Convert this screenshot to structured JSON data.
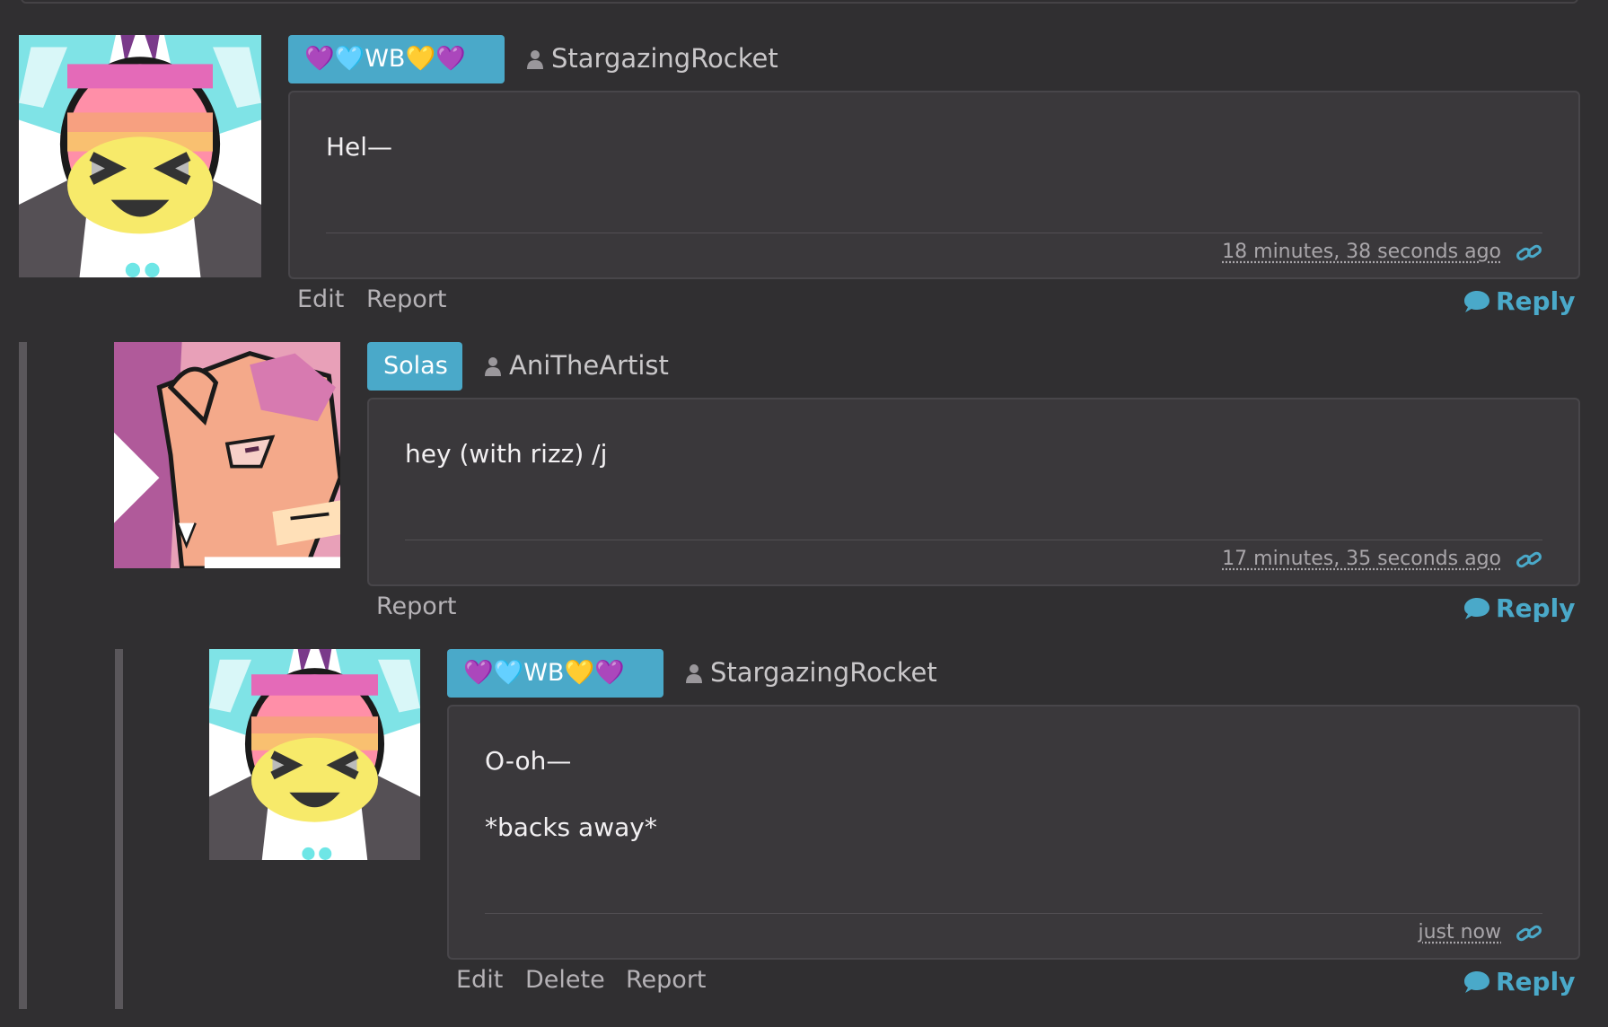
{
  "comments": [
    {
      "badge": "💜🩵WB💛💜",
      "username": "StargazingRocket",
      "body": [
        "Hel—"
      ],
      "timestamp": "18 minutes, 38 seconds ago",
      "actions": [
        "Edit",
        "Report"
      ],
      "reply_label": "Reply"
    },
    {
      "badge": "Solas",
      "username": "AniTheArtist",
      "body": [
        "hey (with rizz) /j"
      ],
      "timestamp": "17 minutes, 35 seconds ago",
      "actions": [
        "Report"
      ],
      "reply_label": "Reply"
    },
    {
      "badge": "💜🩵WB💛💜",
      "username": "StargazingRocket",
      "body": [
        "O-oh—",
        "*backs away*"
      ],
      "timestamp": "just now",
      "actions": [
        "Edit",
        "Delete",
        "Report"
      ],
      "reply_label": "Reply"
    }
  ],
  "colors": {
    "background": "#302f31",
    "badge": "#4aa9c9",
    "reply": "#4aa9c9",
    "comment_box": "#3a383b"
  },
  "icons": [
    "user-icon",
    "link-icon",
    "speech-bubble-icon"
  ]
}
